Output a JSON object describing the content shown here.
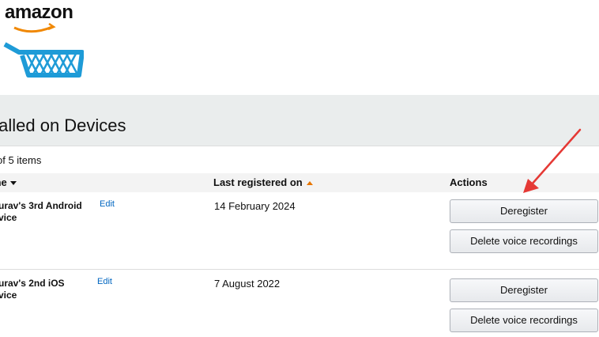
{
  "logo": {
    "text": "amazon"
  },
  "page": {
    "title": "talled on Devices",
    "item_count": "of 5 items"
  },
  "table": {
    "headers": {
      "name": "me",
      "last_registered": "Last registered on",
      "actions": "Actions"
    },
    "rows": [
      {
        "device_name_line1": "urav's 3rd Android",
        "device_name_line2": "vice",
        "edit": "Edit",
        "date": "14 February 2024",
        "deregister": "Deregister",
        "delete_voice": "Delete voice recordings"
      },
      {
        "device_name_line1": "urav's 2nd iOS",
        "device_name_line2": "vice",
        "edit": "Edit",
        "date": "7 August 2022",
        "deregister": "Deregister",
        "delete_voice": "Delete voice recordings"
      }
    ]
  },
  "colors": {
    "link": "#0066c0",
    "sort_accent": "#e77600",
    "annotation_arrow": "#e53935",
    "logo_cart": "#1e9bd7"
  }
}
